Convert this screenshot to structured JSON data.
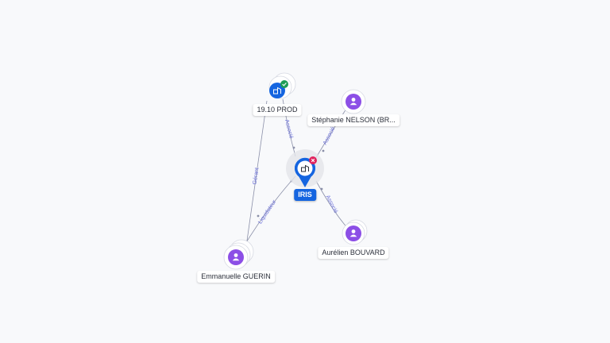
{
  "graph": {
    "center": {
      "label": "IRIS",
      "type": "company",
      "status": "closed"
    },
    "nodes": {
      "prod": {
        "label": "19.10 PROD",
        "type": "company",
        "status": "active"
      },
      "stephanie": {
        "label": "Stéphanie NELSON (BR...",
        "type": "person"
      },
      "aurelien": {
        "label": "Aurélien BOUVARD",
        "type": "person"
      },
      "emmanuelle": {
        "label": "Emmanuelle GUERIN",
        "type": "person"
      }
    },
    "edges": {
      "prod_iris": {
        "label": "Associé"
      },
      "stephanie_iris": {
        "label": "Associé"
      },
      "aurelien_iris": {
        "label": "Associé"
      },
      "emmanuelle_iris": {
        "label": "Liquidateur"
      },
      "emmanuelle_prod": {
        "label": "Gérant"
      }
    }
  },
  "colors": {
    "background": "#f8f9fb",
    "company_blue": "#1565e0",
    "person_purple": "#8c4fe6",
    "edge_line": "#8a8fa8",
    "edge_label": "#6a6fd8",
    "active_green": "#1f9d55",
    "closed_red": "#e0245e"
  }
}
